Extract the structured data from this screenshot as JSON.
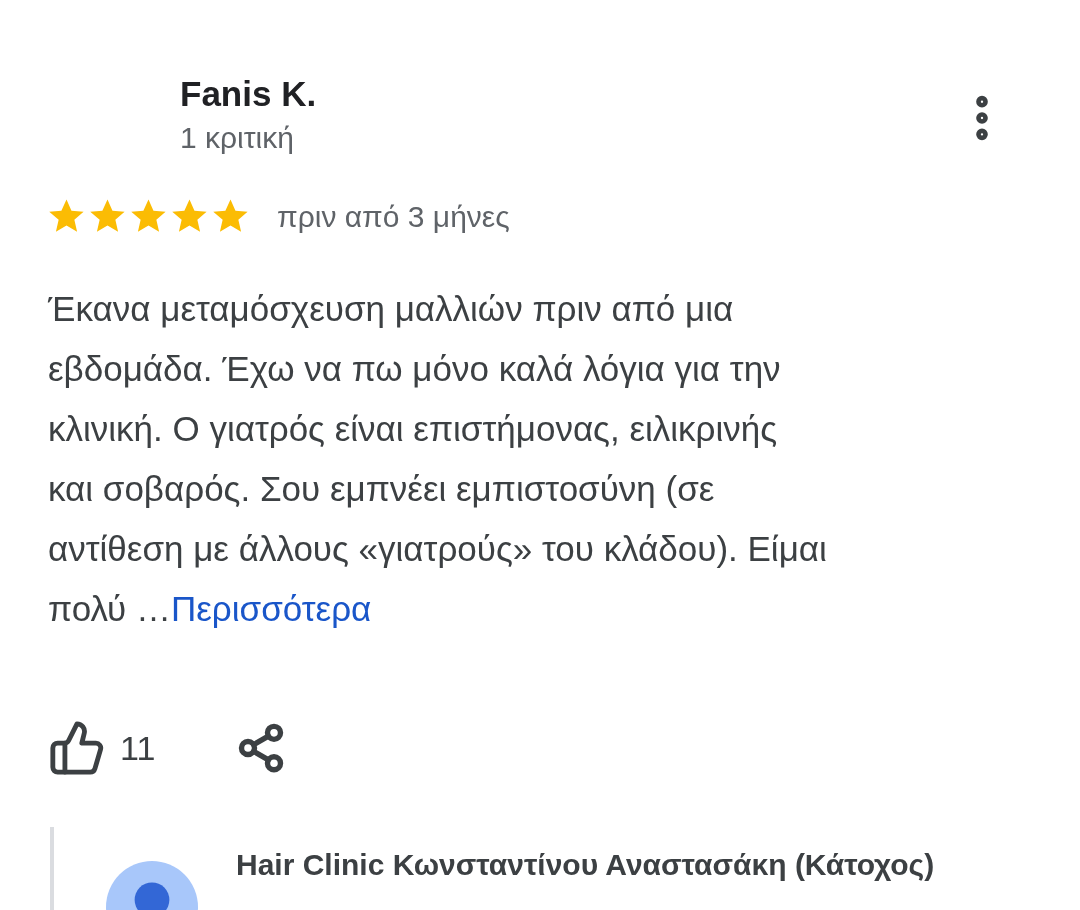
{
  "review": {
    "author": "Fanis K.",
    "review_count": "1 κριτική",
    "stars": 5,
    "date": "πριν από 3 μήνες",
    "body_lines": [
      "Έκανα μεταμόσχευση μαλλιών πριν από μια",
      "εβδομάδα. Έχω να πω μόνο καλά λόγια για την",
      "κλινική. Ο γιατρός είναι επιστήμονας, ειλικρινής",
      "και σοβαρός. Σου εμπνέει εμπιστοσύνη (σε",
      "αντίθεση με άλλους «γιατρούς» του κλάδου). Είμαι",
      "πολύ …"
    ],
    "more_link": "Περισσότερα",
    "likes": "11"
  },
  "owner_reply": {
    "name": "Hair Clinic Κωνσταντίνου Αναστασάκη (Κάτοχος)"
  }
}
